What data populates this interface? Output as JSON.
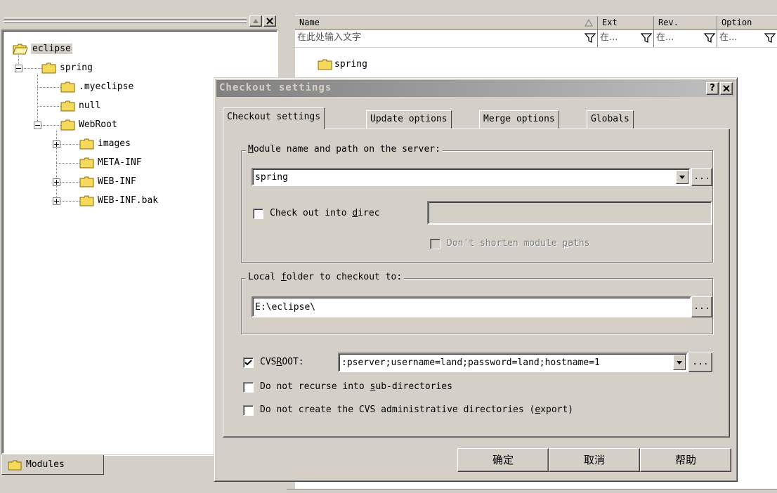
{
  "left_panel": {
    "tree": [
      {
        "label": "eclipse",
        "level": 0,
        "expander": "none",
        "open": true
      },
      {
        "label": "spring",
        "level": 1,
        "expander": "minus"
      },
      {
        "label": ".myeclipse",
        "level": 2,
        "expander": "none"
      },
      {
        "label": "null",
        "level": 2,
        "expander": "none"
      },
      {
        "label": "WebRoot",
        "level": 2,
        "expander": "minus"
      },
      {
        "label": "images",
        "level": 3,
        "expander": "plus"
      },
      {
        "label": "META-INF",
        "level": 3,
        "expander": "none"
      },
      {
        "label": "WEB-INF",
        "level": 3,
        "expander": "plus"
      },
      {
        "label": "WEB-INF.bak",
        "level": 3,
        "expander": "plus"
      }
    ],
    "bottom_tab_label": "Modules"
  },
  "file_list": {
    "columns": [
      "Name",
      "Ext",
      "Rev.",
      "Option"
    ],
    "filter_placeholder_name": "在此处输入文字",
    "filter_placeholder_short": "在...",
    "row_label": "spring"
  },
  "dialog": {
    "title": "Checkout settings",
    "help_glyph": "?",
    "close_glyph": "✕",
    "tabs": [
      "Checkout settings",
      "Update options",
      "Merge options",
      "Globals"
    ],
    "module_group": {
      "legend_before": "",
      "legend_u": "M",
      "legend_after": "odule name and path on the server:",
      "module_value": "spring",
      "browse_label": "...",
      "checkout_into_before": "Check out into ",
      "checkout_into_u": "d",
      "checkout_into_after": "irec",
      "checkout_into_value": "",
      "dont_shorten_before": "Don't shorten module ",
      "dont_shorten_u": "p",
      "dont_shorten_after": "aths"
    },
    "local_group": {
      "legend_before": "Local ",
      "legend_u": "f",
      "legend_after": "older to checkout to:",
      "folder_value": "E:\\eclipse\\",
      "browse_label": "..."
    },
    "cvsroot": {
      "label_before": "CVS",
      "label_u": "R",
      "label_after": "OOT:",
      "value": ":pserver;username=land;password=land;hostname=1",
      "browse_label": "...",
      "checked": true
    },
    "no_recurse": {
      "before": "Do not recurse into ",
      "u": "s",
      "after": "ub-directories",
      "checked": false
    },
    "no_admin": {
      "before": "Do not create the CVS administrative directories (",
      "u": "e",
      "after": "xport)",
      "checked": false
    },
    "buttons": {
      "ok": "确定",
      "cancel": "取消",
      "help": "帮助"
    }
  },
  "colors": {
    "face": "#d4d0c8",
    "title_gradient_start": "#808080",
    "title_gradient_end": "#c0c0c0",
    "folder": "#f5d95c"
  }
}
